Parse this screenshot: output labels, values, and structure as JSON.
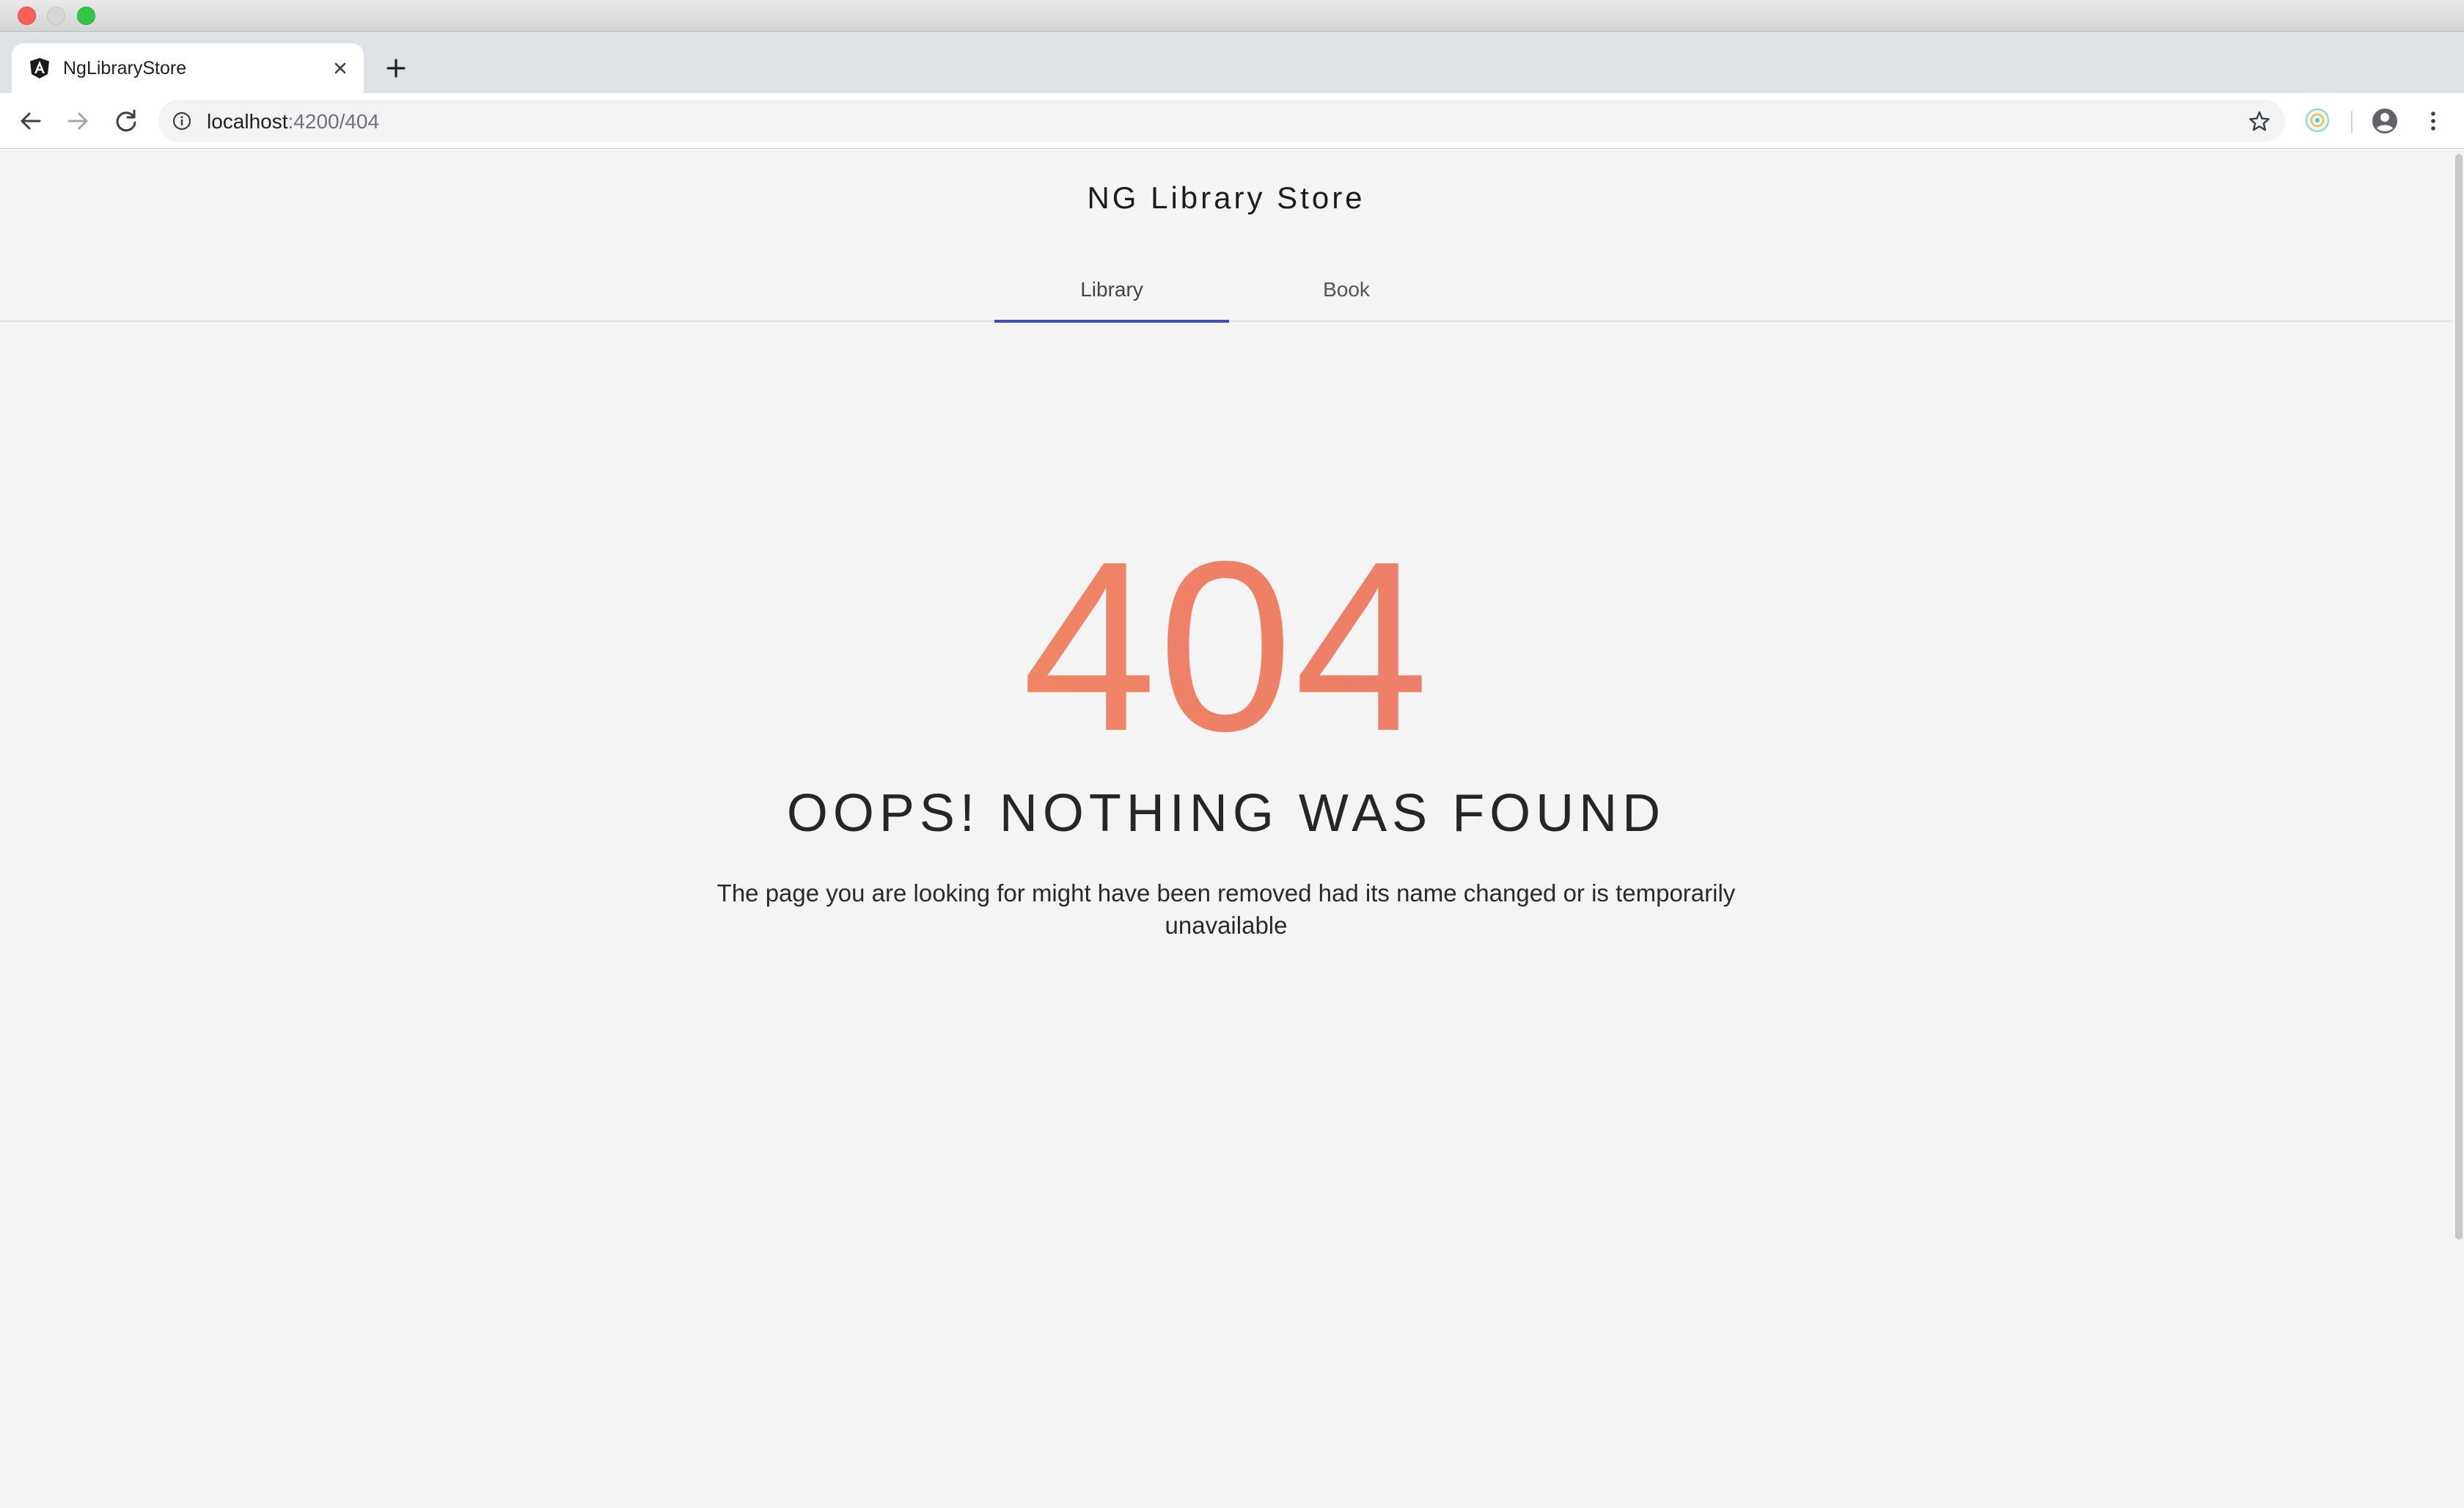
{
  "browser": {
    "tab": {
      "title": "NgLibraryStore",
      "favicon_icon": "angular-logo-icon",
      "close_icon": "close-icon"
    },
    "new_tab_icon": "plus-icon",
    "toolbar": {
      "back_icon": "arrow-left-icon",
      "forward_icon": "arrow-right-icon",
      "reload_icon": "reload-icon",
      "url_host": "localhost",
      "url_path": ":4200/404",
      "info_icon": "info-icon",
      "bookmark_icon": "star-icon",
      "extension_icon": "extension-icon",
      "profile_icon": "account-circle-icon",
      "menu_icon": "more-vert-icon"
    }
  },
  "app": {
    "title": "NG Library Store",
    "tabs": [
      {
        "label": "Library",
        "active": true
      },
      {
        "label": "Book",
        "active": false
      }
    ],
    "accent_color": "#3f51b5"
  },
  "error": {
    "code": "404",
    "title": "OOPS! NOTHING WAS FOUND",
    "description": "The page you are looking for might have been removed had its name changed or is temporarily unavailable",
    "gradient_colors": [
      "#f0a35e",
      "#ec7972"
    ]
  }
}
